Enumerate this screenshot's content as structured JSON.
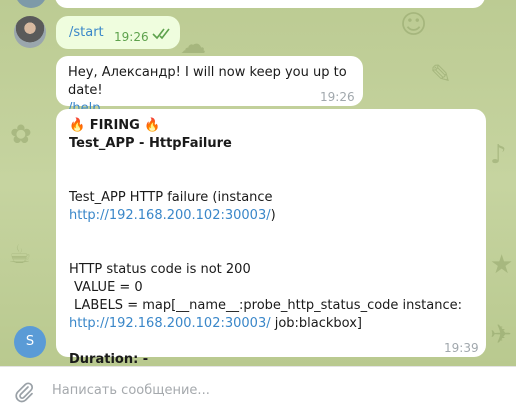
{
  "messages": {
    "start_cmd": "/start",
    "start_time": "19:26",
    "greeting": "Hey, Александр! I will now keep you up to date!",
    "help_cmd": "/help",
    "greeting_time": "19:26",
    "alert": {
      "firing_emoji": "🔥",
      "firing_label": "FIRING",
      "name": "Test_APP - HttpFailure",
      "summary_prefix": "Test_APP HTTP failure (instance ",
      "summary_link": "http://192.168.200.102:30003/",
      "summary_suffix": ")",
      "status_line": "HTTP status code is not 200",
      "value_line": "VALUE = 0",
      "labels_line": "LABELS = map[__name__:probe_http_status_code instance:",
      "labels_link": "http://192.168.200.102:30003/",
      "labels_suffix": " job:blackbox]",
      "duration_label": "Duration: -",
      "time": "19:39"
    }
  },
  "sender_avatar_letter": "S",
  "composer": {
    "placeholder": "Написать сообщение..."
  },
  "colors": {
    "link": "#3a87c9",
    "outgoing_bubble": "#effdde",
    "check": "#5ea24d",
    "avatar": "#5a9bd6"
  }
}
